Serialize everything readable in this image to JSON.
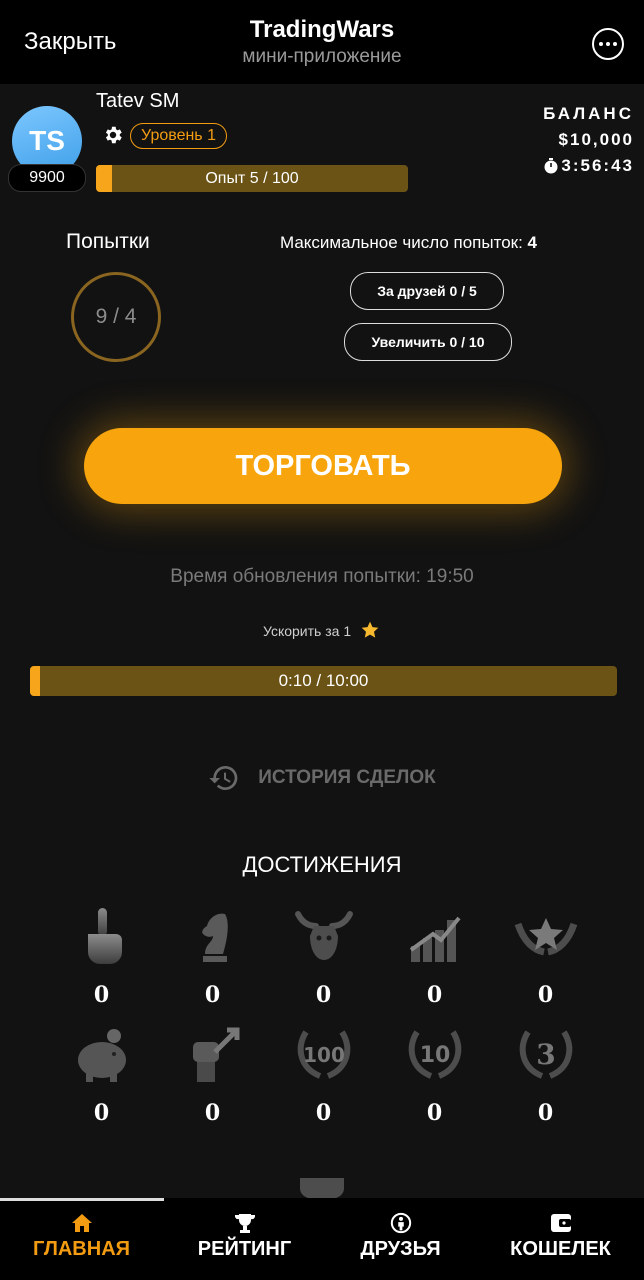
{
  "header": {
    "close_label": "Закрыть",
    "title": "TradingWars",
    "subtitle": "мини-приложение"
  },
  "profile": {
    "initials": "TS",
    "score": "9900",
    "name": "Tatev SM",
    "level": "Уровень 1",
    "xp_text": "Опыт 5 / 100",
    "xp_fraction": 0.05
  },
  "balance": {
    "label": "БАЛАНС",
    "value": "$10,000",
    "timer": "3:56:43"
  },
  "attempts": {
    "title": "Попытки",
    "value": "9 / 4",
    "max_label": "Максимальное число попыток:",
    "max_value": "4",
    "friends_label": "За друзей 0 / 5",
    "increase_label": "Увеличить 0 / 10"
  },
  "trade_button": "ТОРГОВАТЬ",
  "refresh": {
    "text": "Время обновления попытки: 19:50",
    "boost_text": "Ускорить за 1"
  },
  "progress": {
    "text": "0:10 / 10:00",
    "fraction": 0.0167
  },
  "history_label": "ИСТОРИЯ СДЕЛОК",
  "achievements": {
    "title": "ДОСТИЖЕНИЯ",
    "items": [
      {
        "icon": "finger-icon",
        "count": "0"
      },
      {
        "icon": "chess-knight-icon",
        "count": "0"
      },
      {
        "icon": "moose-icon",
        "count": "0"
      },
      {
        "icon": "growth-chart-icon",
        "count": "0"
      },
      {
        "icon": "winged-star-icon",
        "count": "0"
      },
      {
        "icon": "piggy-bank-icon",
        "count": "0"
      },
      {
        "icon": "fist-arrow-icon",
        "count": "0"
      },
      {
        "icon": "laurel-100-icon",
        "label": "100",
        "count": "0"
      },
      {
        "icon": "laurel-10-icon",
        "label": "10",
        "count": "0"
      },
      {
        "icon": "laurel-3-icon",
        "label": "3",
        "count": "0"
      }
    ]
  },
  "nav": {
    "home": "ГЛАВНАЯ",
    "rating": "РЕЙТИНГ",
    "friends": "ДРУЗЬЯ",
    "wallet": "КОШЕЛЕК",
    "active_color": "#f39c12"
  }
}
